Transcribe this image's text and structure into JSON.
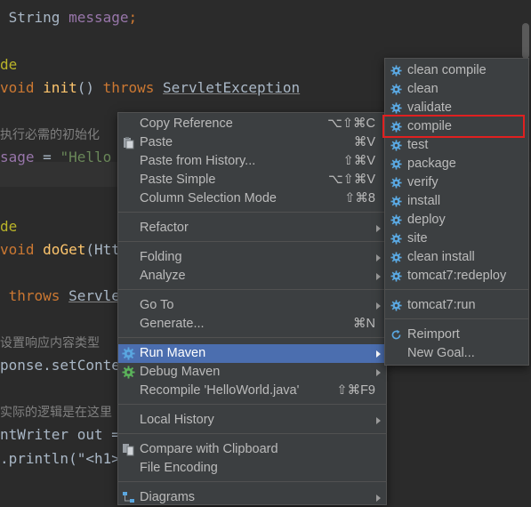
{
  "editor": {
    "lines": [
      {
        "type": "decl",
        "indent": " ",
        "t1": "String ",
        "t2": "message",
        "t3": ";"
      },
      {
        "type": "ann",
        "text": "de"
      },
      {
        "type": "method",
        "kw": "void ",
        "fn": "init",
        "rest": "() ",
        "kw2": "throws ",
        "ex": "ServletException"
      },
      {
        "type": "comment",
        "text": "执行必需的初始化"
      },
      {
        "type": "assign",
        "lhs": "sage ",
        "rest": "= ",
        "str": "\"Hello"
      },
      {
        "type": "ann",
        "text": "de"
      },
      {
        "type": "method2",
        "kw": "void ",
        "fn": "doGet",
        "rest": "(Htt"
      },
      {
        "type": "plain",
        "text": "               Htt"
      },
      {
        "type": "throws",
        "kw": " throws ",
        "ex": "Servle"
      },
      {
        "type": "comment",
        "text": "设置响应内容类型"
      },
      {
        "type": "plain",
        "text": "ponse.setConte"
      },
      {
        "type": "comment",
        "text": "实际的逻辑是在这里"
      },
      {
        "type": "plain",
        "text": "ntWriter out ="
      },
      {
        "type": "println",
        "text": ".println(\"<h1>"
      }
    ]
  },
  "context_menu": {
    "items": [
      {
        "label": "Copy Reference",
        "shortcut": "⌥⇧⌘C"
      },
      {
        "label": "Paste",
        "shortcut": "⌘V",
        "icon": "paste-icon"
      },
      {
        "label": "Paste from History...",
        "shortcut": "⇧⌘V"
      },
      {
        "label": "Paste Simple",
        "shortcut": "⌥⇧⌘V"
      },
      {
        "label": "Column Selection Mode",
        "shortcut": "⇧⌘8"
      },
      {
        "label": "Refactor",
        "submenu": true
      },
      {
        "label": "Folding",
        "submenu": true
      },
      {
        "label": "Analyze",
        "submenu": true
      },
      {
        "label": "Go To",
        "submenu": true
      },
      {
        "label": "Generate...",
        "shortcut": "⌘N"
      },
      {
        "label": "Run Maven",
        "submenu": true,
        "selected": true,
        "icon": "maven-gear-icon"
      },
      {
        "label": "Debug Maven",
        "submenu": true,
        "icon": "debug-gear-icon"
      },
      {
        "label": "Recompile 'HelloWorld.java'",
        "shortcut": "⇧⌘F9"
      },
      {
        "label": "Local History",
        "submenu": true
      },
      {
        "label": "Compare with Clipboard",
        "icon": "compare-icon"
      },
      {
        "label": "File Encoding"
      },
      {
        "label": "Diagrams",
        "submenu": true,
        "icon": "diagram-icon"
      }
    ]
  },
  "run_maven_submenu": {
    "items": [
      {
        "label": "clean compile"
      },
      {
        "label": "clean"
      },
      {
        "label": "validate"
      },
      {
        "label": "compile",
        "highlighted": true
      },
      {
        "label": "test"
      },
      {
        "label": "package"
      },
      {
        "label": "verify"
      },
      {
        "label": "install"
      },
      {
        "label": "deploy"
      },
      {
        "label": "site"
      },
      {
        "label": "clean install"
      },
      {
        "label": "tomcat7:redeploy"
      },
      {
        "label": "tomcat7:run"
      },
      {
        "label": "Reimport",
        "icon": "reimport-icon"
      },
      {
        "label": "New Goal..."
      }
    ]
  },
  "colors": {
    "selection": "#4b6eaf",
    "highlight_box": "#e02020",
    "gear": "#4a9fd8"
  }
}
